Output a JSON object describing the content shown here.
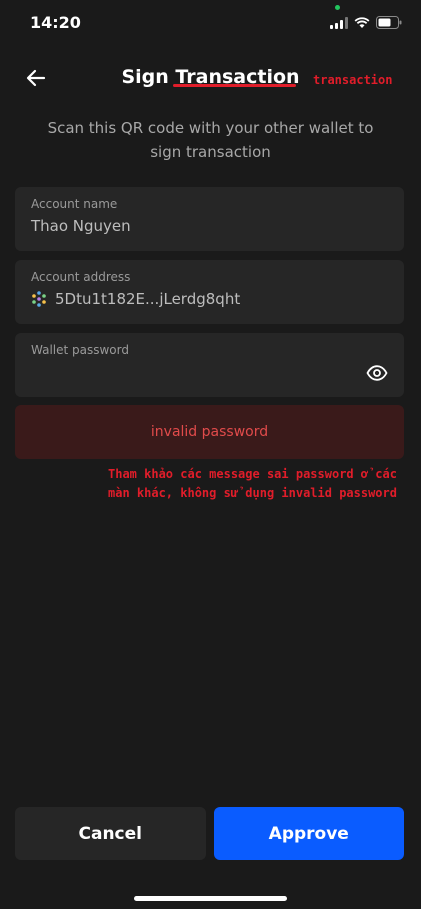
{
  "status_bar": {
    "time": "14:20"
  },
  "header": {
    "title": "Sign Transaction",
    "annotation": "transaction"
  },
  "subtitle": "Scan this QR code with your other wallet to sign transaction",
  "fields": {
    "account_name": {
      "label": "Account name",
      "value": "Thao Nguyen"
    },
    "account_address": {
      "label": "Account address",
      "value": "5Dtu1t182E...jLerdg8qht"
    },
    "wallet_password": {
      "label": "Wallet password",
      "value": ""
    }
  },
  "error": {
    "message": "invalid password"
  },
  "annotation_note": "Tham khảo các message sai password ở các màn khác, không sử dụng invalid password",
  "buttons": {
    "cancel": "Cancel",
    "approve": "Approve"
  },
  "colors": {
    "accent": "#0a5cff",
    "error": "#e14b4b",
    "annotation": "#e11d2a",
    "background": "#1a1a1a"
  }
}
